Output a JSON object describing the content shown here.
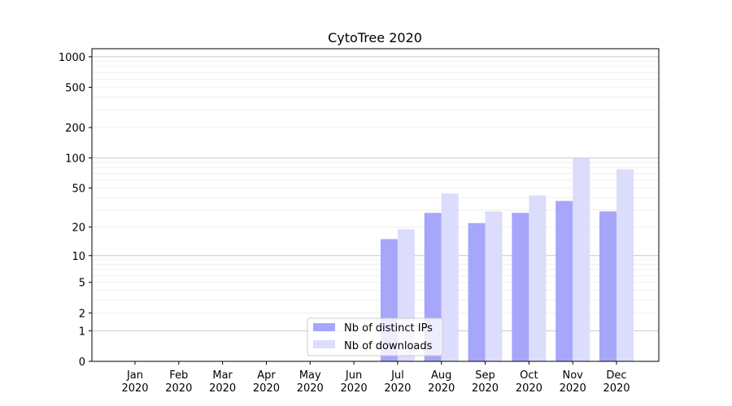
{
  "chart_data": {
    "type": "bar",
    "title": "CytoTree 2020",
    "xlabel": "",
    "ylabel": "",
    "yscale": "log(1+y)",
    "ylim": [
      0,
      1200
    ],
    "grid": {
      "y_major": true,
      "y_minor": true,
      "x": false
    },
    "legend": {
      "placement": "lower-center"
    },
    "categories": [
      "Jan\n2020",
      "Feb\n2020",
      "Mar\n2020",
      "Apr\n2020",
      "May\n2020",
      "Jun\n2020",
      "Jul\n2020",
      "Aug\n2020",
      "Sep\n2020",
      "Oct\n2020",
      "Nov\n2020",
      "Dec\n2020"
    ],
    "yticks": [
      {
        "value": 0,
        "label": "0"
      },
      {
        "value": 1,
        "label": "1"
      },
      {
        "value": 2,
        "label": "2"
      },
      {
        "value": 5,
        "label": "5"
      },
      {
        "value": 10,
        "label": "10"
      },
      {
        "value": 20,
        "label": "20"
      },
      {
        "value": 50,
        "label": "50"
      },
      {
        "value": 100,
        "label": "100"
      },
      {
        "value": 200,
        "label": "200"
      },
      {
        "value": 500,
        "label": "500"
      },
      {
        "value": 1000,
        "label": "1000"
      }
    ],
    "series": [
      {
        "name": "Nb of distinct IPs",
        "color": "#a6a6fb",
        "values": [
          0,
          0,
          0,
          0,
          0,
          0,
          15,
          28,
          22,
          28,
          37,
          29
        ]
      },
      {
        "name": "Nb of downloads",
        "color": "#dcdcfc",
        "values": [
          0,
          0,
          0,
          0,
          0,
          0,
          19,
          44,
          29,
          42,
          100,
          77
        ]
      }
    ]
  }
}
